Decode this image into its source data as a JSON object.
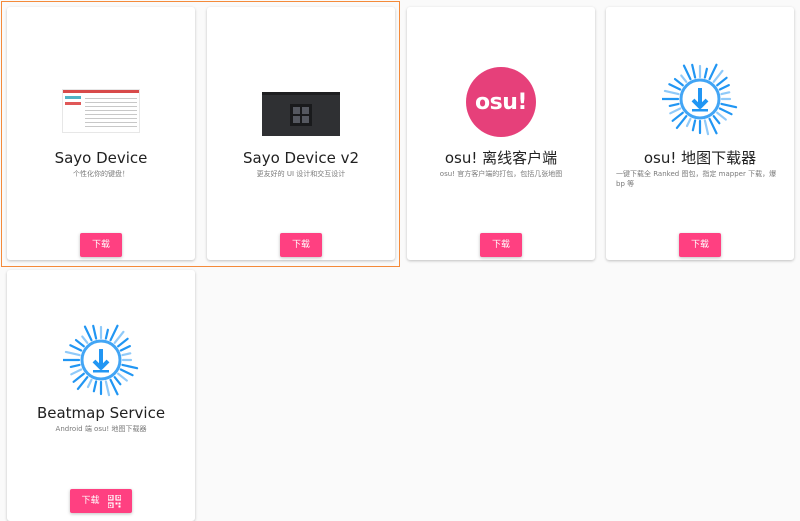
{
  "cards": [
    {
      "title": "Sayo Device",
      "description": "个性化你的键盘！",
      "button": "下载"
    },
    {
      "title": "Sayo Device v2",
      "description": "更友好的 UI 设计和交互设计",
      "button": "下载"
    },
    {
      "title": "osu! 离线客户端",
      "description": "osu! 官方客户端的打包，包括几张地图",
      "button": "下载",
      "logo_text": "osu!"
    },
    {
      "title": "osu! 地图下载器",
      "description": "一键下载全 Ranked 图包，指定 mapper 下载，爆 bp 等",
      "button": "下载"
    },
    {
      "title": "Beatmap Service",
      "description": "Android 端 osu! 地图下载器",
      "button": "下载"
    }
  ],
  "colors": {
    "accent": "#ff4081",
    "osu_pink": "#e6407a",
    "download_blue": "#2196f3",
    "selection_outline": "#f48a3a"
  },
  "icons": {
    "download": "download-burst-icon",
    "qr": "qr-code-icon"
  }
}
